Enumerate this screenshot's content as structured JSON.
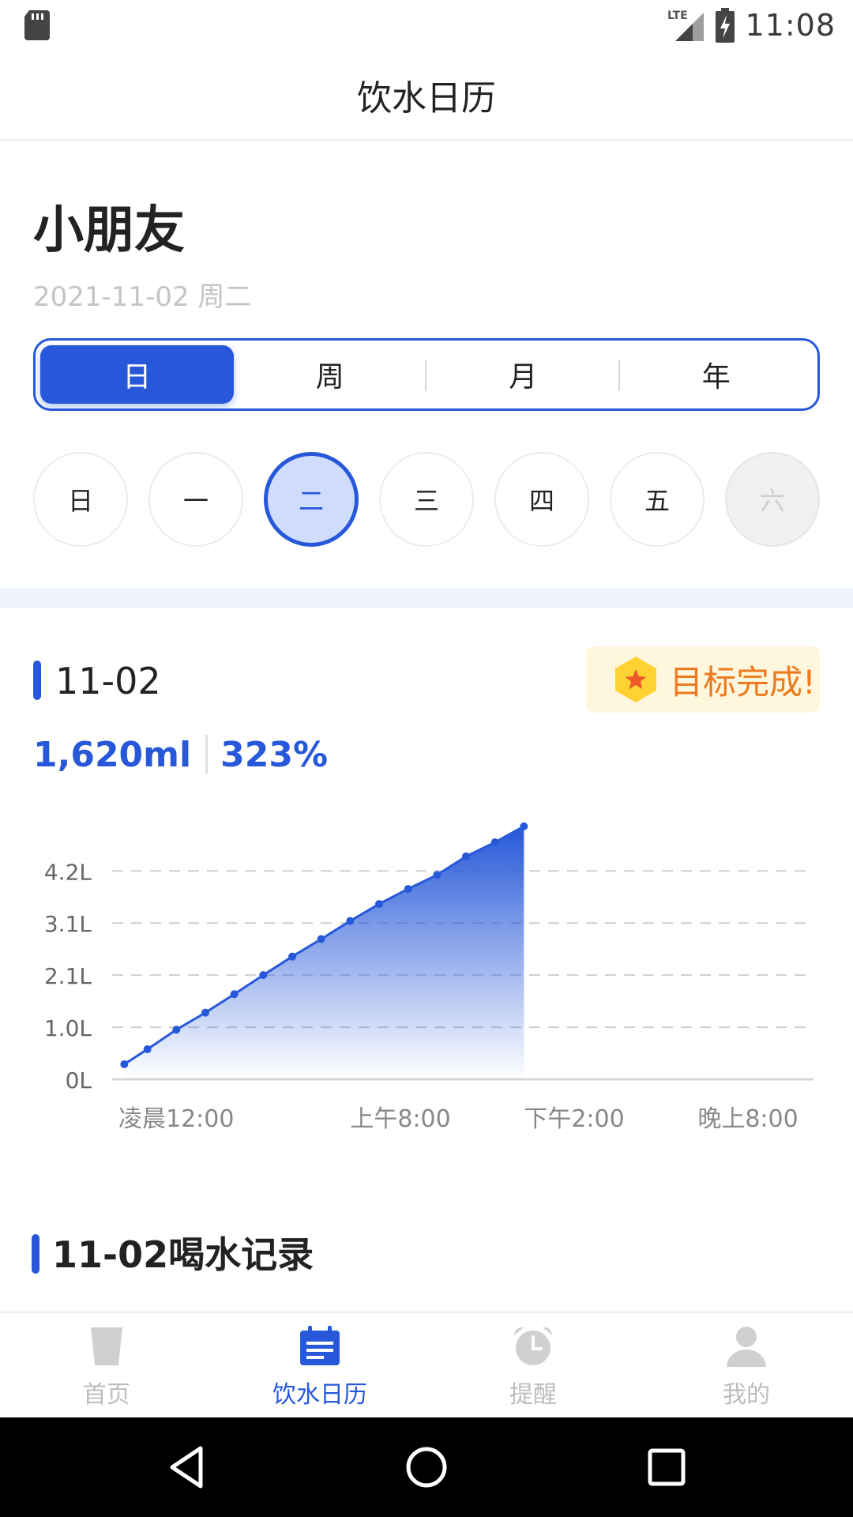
{
  "status_bar": {
    "time": "11:08",
    "network_label": "LTE"
  },
  "header": {
    "title": "饮水日历"
  },
  "user": {
    "name": "小朋友",
    "date": "2021-11-02 周二"
  },
  "period_tabs": [
    {
      "label": "日",
      "active": true
    },
    {
      "label": "周",
      "active": false
    },
    {
      "label": "月",
      "active": false
    },
    {
      "label": "年",
      "active": false
    }
  ],
  "weekdays": [
    {
      "label": "日",
      "state": "normal"
    },
    {
      "label": "一",
      "state": "normal"
    },
    {
      "label": "二",
      "state": "selected"
    },
    {
      "label": "三",
      "state": "normal"
    },
    {
      "label": "四",
      "state": "normal"
    },
    {
      "label": "五",
      "state": "normal"
    },
    {
      "label": "六",
      "state": "disabled"
    }
  ],
  "summary": {
    "date": "11-02",
    "amount": "1,620ml",
    "percent": "323%",
    "goal_badge": "目标完成!"
  },
  "chart_data": {
    "type": "area",
    "y_tick_labels": [
      "0L",
      "1.0L",
      "2.1L",
      "3.1L",
      "4.2L"
    ],
    "y_tick_values": [
      0,
      1.04,
      2.08,
      3.12,
      4.16
    ],
    "ylim": [
      0,
      5.3
    ],
    "x_tick_labels": [
      "凌晨12:00",
      "上午8:00",
      "下午2:00",
      "晚上8:00"
    ],
    "x_tick_hours": [
      0,
      8,
      14,
      20
    ],
    "xlim_hours": [
      0,
      24
    ],
    "points": [
      {
        "hour": 0.2,
        "liters": 0.3
      },
      {
        "hour": 1.0,
        "liters": 0.6
      },
      {
        "hour": 2.0,
        "liters": 0.99
      },
      {
        "hour": 3.0,
        "liters": 1.33
      },
      {
        "hour": 4.0,
        "liters": 1.7
      },
      {
        "hour": 5.0,
        "liters": 2.08
      },
      {
        "hour": 6.0,
        "liters": 2.45
      },
      {
        "hour": 7.0,
        "liters": 2.8
      },
      {
        "hour": 8.0,
        "liters": 3.16
      },
      {
        "hour": 9.0,
        "liters": 3.5
      },
      {
        "hour": 10.0,
        "liters": 3.8
      },
      {
        "hour": 11.0,
        "liters": 4.08
      },
      {
        "hour": 12.0,
        "liters": 4.45
      },
      {
        "hour": 13.0,
        "liters": 4.73
      },
      {
        "hour": 14.0,
        "liters": 5.05
      }
    ],
    "grid": "dashed-horizontal",
    "line_color": "#2658d9",
    "fill_color": "#2658d9"
  },
  "records": {
    "title": "11-02喝水记录"
  },
  "tab_bar": [
    {
      "label": "首页",
      "icon": "cup-icon",
      "active": false
    },
    {
      "label": "饮水日历",
      "icon": "calendar-icon",
      "active": true
    },
    {
      "label": "提醒",
      "icon": "alarm-clock-icon",
      "active": false
    },
    {
      "label": "我的",
      "icon": "user-icon",
      "active": false
    }
  ],
  "colors": {
    "accent": "#2658d9",
    "accent_light": "#cfdcfb",
    "goal_text": "#ee7a1e",
    "goal_bg": "#fff7dd",
    "goal_hexagon": "#ffd233",
    "muted": "#bdbdbd"
  }
}
